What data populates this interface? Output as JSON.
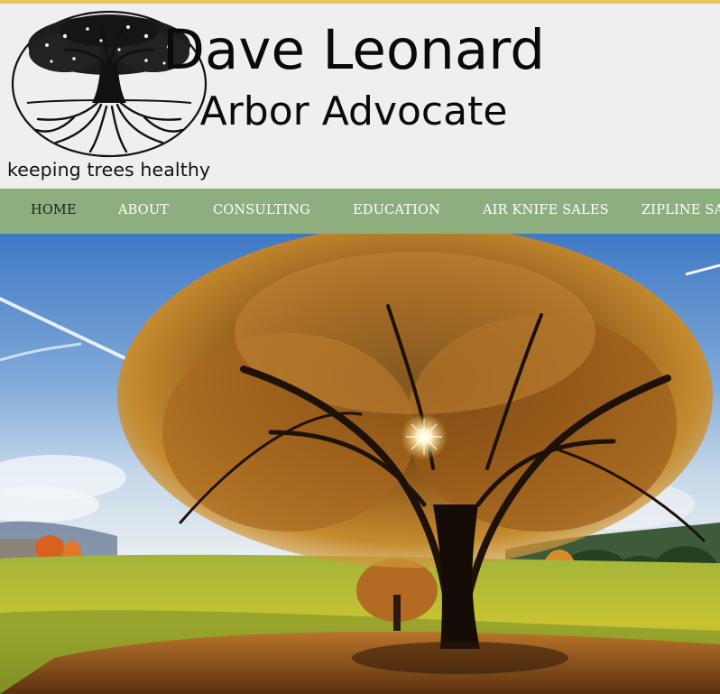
{
  "header": {
    "title": "Dave Leonard",
    "subtitle": "Arbor Advocate",
    "tagline": "keeping trees healthy",
    "logo_icon": "tree-of-life-logo-icon"
  },
  "nav": {
    "items": [
      {
        "label": "HOME",
        "active": true
      },
      {
        "label": "ABOUT",
        "active": false
      },
      {
        "label": "CONSULTING",
        "active": false
      },
      {
        "label": "EDUCATION",
        "active": false
      },
      {
        "label": "AIR KNIFE SALES",
        "active": false
      },
      {
        "label": "ZIPLINE SALES",
        "active": false
      }
    ]
  },
  "hero": {
    "image": "autumn-oak-tree-in-meadow"
  },
  "colors": {
    "accent_stripe": "#e7c75a",
    "header_bg": "#efefef",
    "nav_bg": "#8dae7e",
    "nav_text": "#ffffff",
    "nav_active_text": "#1a2414"
  }
}
